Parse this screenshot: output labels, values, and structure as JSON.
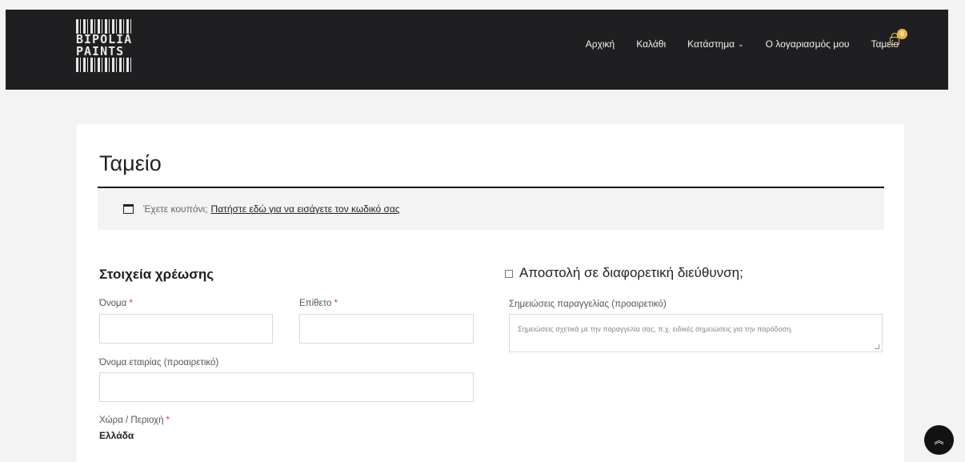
{
  "brand": {
    "logo_line1": "BIPOLIA",
    "logo_line2": "PAINTS"
  },
  "nav": {
    "items": [
      "Αρχική",
      "Καλάθι",
      "Κατάστημα",
      "Ο λογαριασμός μου",
      "Ταμείο"
    ],
    "shop_chevron": "⌄",
    "cart_count": "0"
  },
  "page": {
    "title": "Ταμείο",
    "coupon_text": "Έχετε κουπόνι;",
    "coupon_link": "Πατήστε εδώ για να εισάγετε τον κωδικό σας"
  },
  "billing": {
    "title": "Στοιχεία χρέωσης",
    "first_name_label": "Όνομα",
    "last_name_label": "Επίθετο",
    "company_label": "Όνομα εταιρίας (προαιρετικό)",
    "country_label": "Χώρα / Περιοχή",
    "country_value": "Ελλάδα",
    "required_mark": "*"
  },
  "shipping": {
    "different_address_label": "Αποστολή σε διαφορετική διεύθυνση;",
    "notes_label": "Σημειώσεις παραγγελίας (προαιρετικό)",
    "notes_placeholder": "Σημειώσεις σχετικά με την παραγγελία σας, π.χ. ειδικές σημειώσεις για την παράδοση."
  },
  "colors": {
    "header_bg": "#1f1f21",
    "accent": "#e8b64a",
    "required": "#d43a3a"
  },
  "icons": {
    "cart": "cart-icon",
    "scroll_top": "double-chevron-up-icon"
  }
}
